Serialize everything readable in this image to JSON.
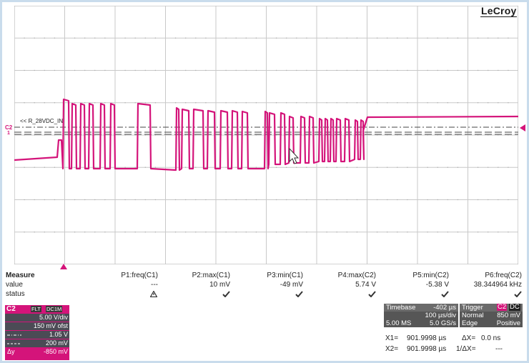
{
  "brand": "LeCroy",
  "trace": {
    "channel_marker": "C2",
    "level_marker": "1",
    "label": "<< R_28VDC_IN",
    "color": "#d4147a"
  },
  "measure": {
    "title": "Measure",
    "row_labels": [
      "value",
      "status"
    ],
    "columns": [
      {
        "header": "P1:freq(C1)",
        "value": "---",
        "status": "warning-icon"
      },
      {
        "header": "P2:max(C1)",
        "value": "10 mV",
        "status": "check-icon"
      },
      {
        "header": "P3:min(C1)",
        "value": "-49 mV",
        "status": "check-icon"
      },
      {
        "header": "P4:max(C2)",
        "value": "5.74 V",
        "status": "check-icon"
      },
      {
        "header": "P5:min(C2)",
        "value": "-5.38 V",
        "status": "check-icon"
      },
      {
        "header": "P6:freq(C2)",
        "value": "38.344964 kHz",
        "status": "check-icon"
      }
    ]
  },
  "channel_box": {
    "name": "C2",
    "badge1": "FLT",
    "badge2": "DC1M",
    "vdiv": "5.00 V/div",
    "offset": "150 mV ofst",
    "level1_value": "1.05 V",
    "level2_value": "200 mV",
    "dy_label": "Δy",
    "dy_value": "-850 mV"
  },
  "timebase": {
    "title": "Timebase",
    "delay": "-402 µs",
    "tdiv": "100 µs/div",
    "samples": "5.00 MS",
    "rate": "5.0 GS/s"
  },
  "trigger": {
    "title": "Trigger",
    "source": "C2",
    "coupling": "DC",
    "mode": "Normal",
    "level": "850 mV",
    "type": "Edge",
    "slope": "Positive"
  },
  "cursors": {
    "x1_label": "X1=",
    "x1_value": "901.9998 µs",
    "x2_label": "X2=",
    "x2_value": "901.9998 µs",
    "dx_label": "ΔX=",
    "dx_value": "0.0 ns",
    "inv_dx_label": "1/ΔX=",
    "inv_dx_value": "---"
  }
}
